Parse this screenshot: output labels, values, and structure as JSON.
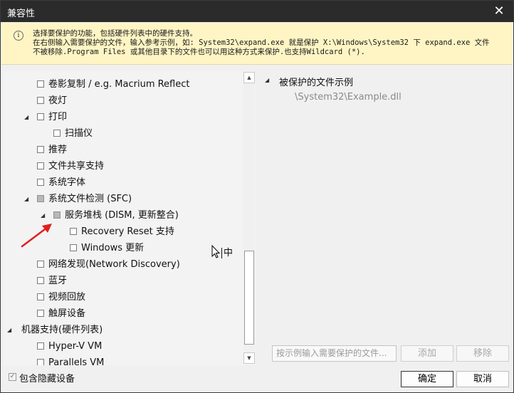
{
  "window": {
    "title": "兼容性",
    "close_glyph": "✕"
  },
  "info": {
    "icon": "info-icon",
    "lines": [
      "选择要保护的功能，包括硬件列表中的硬件支持。",
      "在右侧输入需要保护的文件，输入参考示例，如: System32\\expand.exe 就是保护 X:\\Windows\\System32 下 expand.exe 文件",
      "不被移除.Program Files 或其他目录下的文件也可以用这种方式来保护.也支持Wildcard (*)."
    ]
  },
  "tree": {
    "items": [
      {
        "label": "卷影复制 / e.g. Macrium Reflect",
        "indent": 1,
        "expander": "",
        "state": "unchecked"
      },
      {
        "label": "夜灯",
        "indent": 1,
        "expander": "",
        "state": "unchecked"
      },
      {
        "label": "打印",
        "indent": 1,
        "expander": "◢",
        "state": "unchecked"
      },
      {
        "label": "扫描仪",
        "indent": 2,
        "expander": "",
        "state": "unchecked"
      },
      {
        "label": "推荐",
        "indent": 1,
        "expander": "",
        "state": "unchecked"
      },
      {
        "label": "文件共享支持",
        "indent": 1,
        "expander": "",
        "state": "unchecked"
      },
      {
        "label": "系统字体",
        "indent": 1,
        "expander": "",
        "state": "unchecked"
      },
      {
        "label": "系统文件检测 (SFC)",
        "indent": 1,
        "expander": "◢",
        "state": "partial"
      },
      {
        "label": "服务堆栈 (DISM, 更新整合)",
        "indent": 2,
        "expander": "◢",
        "state": "partial"
      },
      {
        "label": "Recovery Reset 支持",
        "indent": 3,
        "expander": "",
        "state": "unchecked"
      },
      {
        "label": "Windows 更新",
        "indent": 3,
        "expander": "",
        "state": "unchecked"
      },
      {
        "label": "网络发现(Network Discovery)",
        "indent": 1,
        "expander": "",
        "state": "unchecked"
      },
      {
        "label": "蓝牙",
        "indent": 1,
        "expander": "",
        "state": "unchecked"
      },
      {
        "label": "视频回放",
        "indent": 1,
        "expander": "",
        "state": "unchecked"
      },
      {
        "label": "触屏设备",
        "indent": 1,
        "expander": "",
        "state": "unchecked"
      },
      {
        "label": "机器支持(硬件列表)",
        "indent": 0,
        "expander": "◢",
        "state": "none"
      },
      {
        "label": "Hyper-V VM",
        "indent": 1,
        "expander": "",
        "state": "unchecked"
      },
      {
        "label": "Parallels VM",
        "indent": 1,
        "expander": "",
        "state": "unchecked"
      }
    ]
  },
  "scrollbar": {
    "up_glyph": "▲",
    "down_glyph": "▼"
  },
  "ime": {
    "text": "中"
  },
  "right": {
    "expander": "◢",
    "heading": "被保护的文件示例",
    "example": "\\System32\\Example.dll"
  },
  "file_input": {
    "placeholder": "按示例输入需要保护的文件..."
  },
  "buttons": {
    "add": "添加",
    "remove": "移除",
    "ok": "确定",
    "cancel": "取消"
  },
  "show_hidden": {
    "label": "包含隐藏设备",
    "checked": true,
    "check_glyph": "✓"
  },
  "colors": {
    "titlebar": "#2b2b2b",
    "info_bg": "#fff5c4",
    "annotation_arrow": "#e02020"
  }
}
